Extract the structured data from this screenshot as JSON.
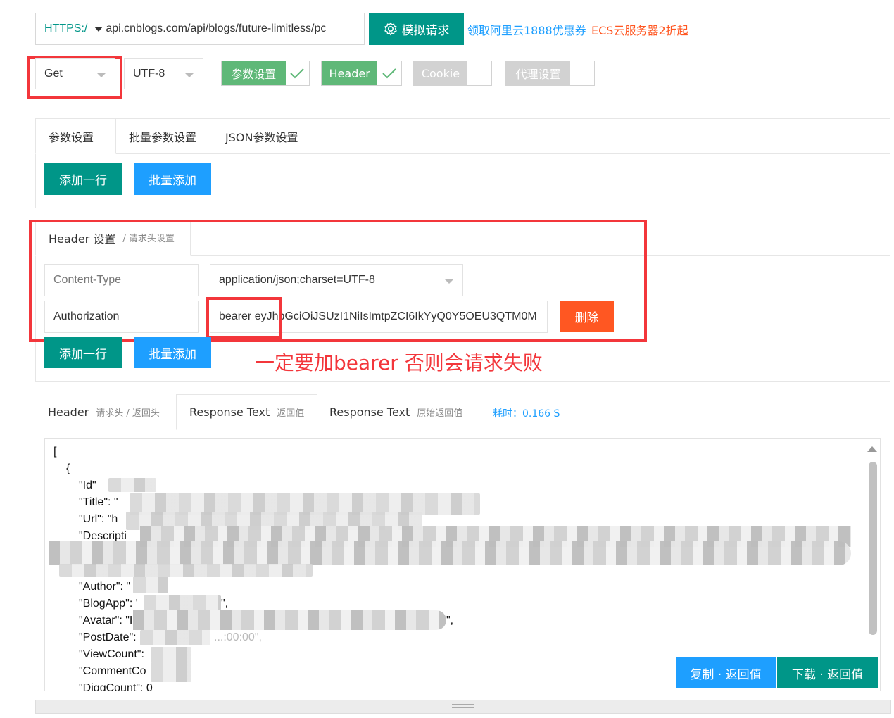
{
  "request": {
    "protocol": "HTTPS:/",
    "url": "api.cnblogs.com/api/blogs/future-limitless/pc",
    "simulate_label": "模拟请求",
    "promo_blue": "领取阿里云1888优惠券",
    "promo_orange": "ECS云服务器2折起"
  },
  "options": {
    "method": "Get",
    "charset": "UTF-8",
    "toggles": [
      {
        "label": "参数设置",
        "checked": true
      },
      {
        "label": "Header",
        "checked": true
      },
      {
        "label": "Cookie",
        "checked": false
      },
      {
        "label": "代理设置",
        "checked": false
      }
    ]
  },
  "param_tabs": [
    "参数设置",
    "批量参数设置",
    "JSON参数设置"
  ],
  "buttons": {
    "add_row": "添加一行",
    "batch_add": "批量添加",
    "delete": "删除"
  },
  "header_section": {
    "title": "Header 设置",
    "subtitle": "/ 请求头设置",
    "rows": [
      {
        "key": "Content-Type",
        "value": "application/json;charset=UTF-8"
      },
      {
        "key": "Authorization",
        "value": "bearer eyJhbGciOiJSUzI1NiIsImtpZCI6IkYyQ0Y5OEU3QTM0M"
      }
    ]
  },
  "annotation": "一定要加bearer 否则会请求失败",
  "response_tabs": [
    {
      "label": "Header",
      "sub": "请求头 / 返回头"
    },
    {
      "label": "Response Text",
      "sub": "返回值"
    },
    {
      "label": "Response Text",
      "sub": "原始返回值"
    }
  ],
  "elapsed": "耗时：0.166 S",
  "response_lines": [
    "[",
    "{",
    "\"Id\"",
    "\"Title\": \"",
    "\"Url\": \"h",
    "\"Descripti",
    "\"Author\": \"",
    "\"BlogApp\": '",
    "\"Avatar\": \"I",
    "\"PostDate\":",
    "\"ViewCount\":",
    "\"CommentCo",
    "\"DiggCount\": 0"
  ],
  "response_fragments": {
    "blogapp_tail": "\",",
    "avatar_tail": "\",",
    "postdate_tail": "...:00:00\","
  },
  "response_buttons": {
    "copy": "复制 · 返回值",
    "download": "下载 · 返回值"
  },
  "colors": {
    "primary": "#009688",
    "blue": "#1e9fff",
    "orange": "#ff5722",
    "red_annotation": "#f3363b",
    "toggle_on": "#5fb878",
    "toggle_off": "#d2d2d2"
  }
}
